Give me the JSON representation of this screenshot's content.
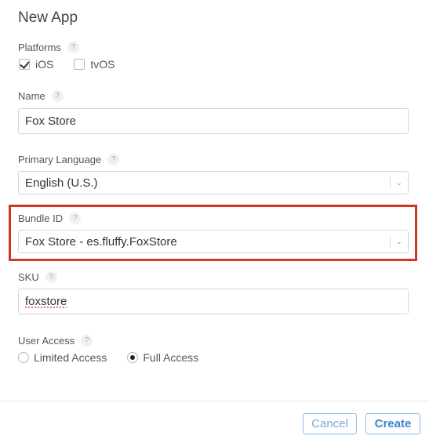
{
  "dialog": {
    "title": "New App"
  },
  "platforms": {
    "label": "Platforms",
    "help": "?",
    "options": [
      {
        "label": "iOS",
        "checked": true
      },
      {
        "label": "tvOS",
        "checked": false
      }
    ]
  },
  "name": {
    "label": "Name",
    "help": "?",
    "value": "Fox Store"
  },
  "primary_language": {
    "label": "Primary Language",
    "help": "?",
    "value": "English (U.S.)",
    "icon": "chevron-down-icon"
  },
  "bundle_id": {
    "label": "Bundle ID",
    "help": "?",
    "value": "Fox Store - es.fluffy.FoxStore",
    "icon": "chevron-down-icon",
    "highlight_color": "#d0391e"
  },
  "sku": {
    "label": "SKU",
    "help": "?",
    "value": "foxstore"
  },
  "user_access": {
    "label": "User Access",
    "help": "?",
    "options": [
      {
        "label": "Limited Access",
        "selected": false
      },
      {
        "label": "Full Access",
        "selected": true
      }
    ]
  },
  "footer": {
    "cancel_label": "Cancel",
    "create_label": "Create",
    "accent_color": "#3a7fd0"
  },
  "glyphs": {
    "chevron": "⌄"
  }
}
